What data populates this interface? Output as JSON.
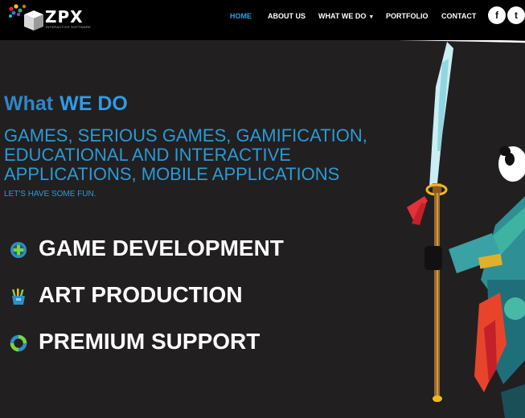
{
  "brand": {
    "name": "ZPX",
    "tagline": "INTERACTIVE SOFTWARE"
  },
  "nav": {
    "items": [
      {
        "label": "HOME",
        "active": true
      },
      {
        "label": "ABOUT US"
      },
      {
        "label": "WHAT WE DO",
        "has_dropdown": true
      },
      {
        "label": "PORTFOLIO"
      },
      {
        "label": "CONTACT"
      }
    ],
    "social": [
      {
        "name": "facebook",
        "glyph": "f",
        "icon": "facebook-icon"
      },
      {
        "name": "twitter",
        "glyph": "t",
        "icon": "twitter-icon"
      }
    ]
  },
  "hero": {
    "heading_prefix": "What",
    "heading_highlight": "WE DO",
    "services_lines": [
      "GAMES, SERIOUS GAMES, GAMIFICATION,",
      "EDUCATIONAL AND INTERACTIVE",
      "APPLICATIONS, MOBILE APPLICATIONS"
    ],
    "tagline": "LET'S HAVE SOME FUN."
  },
  "features": [
    {
      "label": "GAME DEVELOPMENT",
      "icon": "plus-circle-icon"
    },
    {
      "label": "ART PRODUCTION",
      "icon": "paint-cup-icon"
    },
    {
      "label": "PREMIUM SUPPORT",
      "icon": "support-ring-icon"
    }
  ],
  "colors": {
    "accent": "#2c9fe0",
    "background": "#221f20",
    "header": "#000000",
    "text": "#ffffff"
  }
}
